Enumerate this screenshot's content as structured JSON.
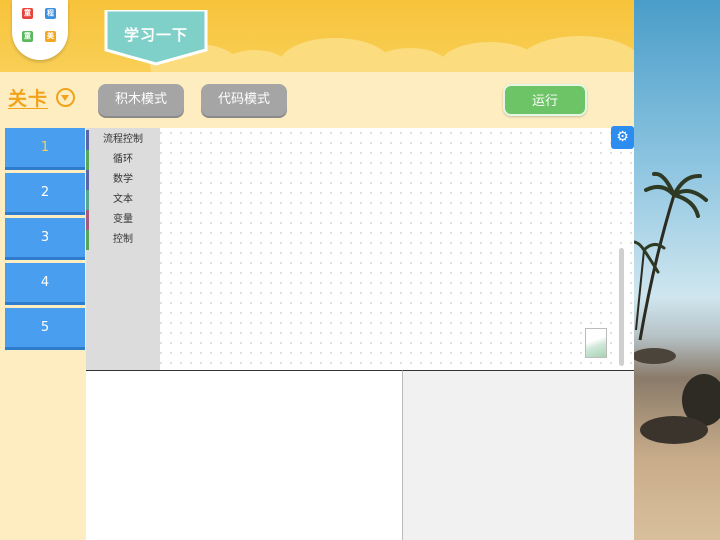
{
  "header": {
    "logo_chars": [
      "童",
      "程",
      "童",
      "美"
    ],
    "logo_colors": [
      "#e8423a",
      "#3a8fe0",
      "#5cb85c",
      "#f5a623"
    ],
    "banner_title": "学习一下"
  },
  "levels": {
    "title": "关卡",
    "items": [
      {
        "label": "1",
        "active": true
      },
      {
        "label": "2",
        "active": false
      },
      {
        "label": "3",
        "active": false
      },
      {
        "label": "4",
        "active": false
      },
      {
        "label": "5",
        "active": false
      }
    ]
  },
  "toolbar": {
    "block_mode_label": "积木模式",
    "code_mode_label": "代码模式",
    "run_label": "运行"
  },
  "toolbox": {
    "categories": [
      {
        "label": "流程控制",
        "color": "#5b67a5"
      },
      {
        "label": "循环",
        "color": "#5ba55b"
      },
      {
        "label": "数学",
        "color": "#5b67a5"
      },
      {
        "label": "文本",
        "color": "#5ba58c"
      },
      {
        "label": "变量",
        "color": "#a55b80"
      },
      {
        "label": "控制",
        "color": "#5ba55b"
      }
    ]
  },
  "colors": {
    "header_yellow": "#f7c33a",
    "level_blue": "#4a9ef0",
    "run_green": "#6cc466",
    "mode_gray": "#a5a5a5"
  }
}
